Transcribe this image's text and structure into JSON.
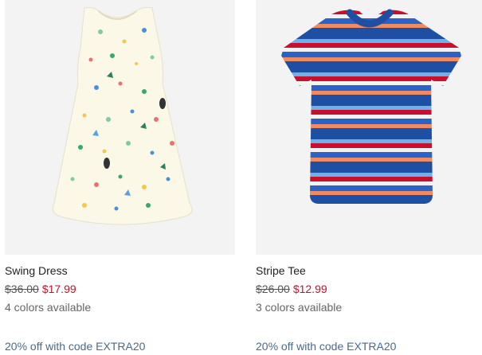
{
  "products": [
    {
      "name": "Swing Dress",
      "original_price": "$36.00",
      "sale_price": "$17.99",
      "colors": "4 colors available",
      "promo": "20% off with code EXTRA20",
      "image_icon": "dress-product-image"
    },
    {
      "name": "Stripe Tee",
      "original_price": "$26.00",
      "sale_price": "$12.99",
      "colors": "3 colors available",
      "promo": "20% off with code EXTRA20",
      "image_icon": "tee-product-image"
    }
  ],
  "colors": {
    "sale_price": "#c8102e",
    "promo": "#4a6a8a",
    "image_bg": "#f3f3f3"
  }
}
